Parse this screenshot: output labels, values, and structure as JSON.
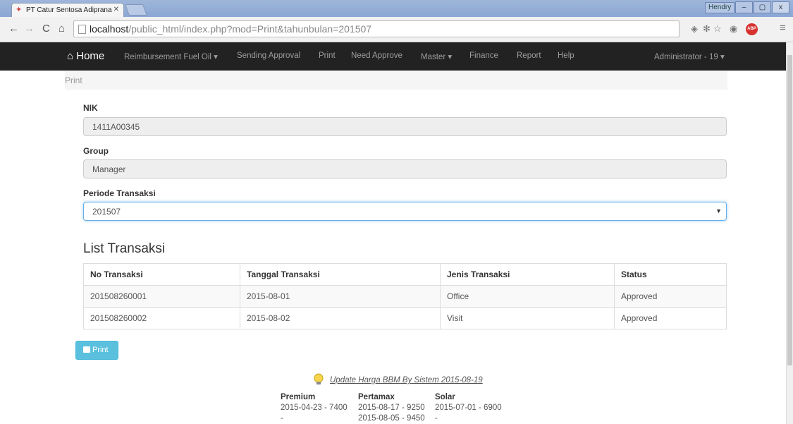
{
  "browser": {
    "tab_title": "PT Catur Sentosa Adiprana",
    "url_host": "localhost",
    "url_path": "/public_html/index.php?mod=Print&tahunbulan=201507",
    "user_badge": "Hendry",
    "minimize": "–",
    "maximize": "▢",
    "close": "x"
  },
  "navbar": {
    "home": "Home",
    "items": [
      "Reimbursement Fuel Oil",
      "Sending Approval",
      "Print",
      "Need Approve",
      "Master",
      "Finance",
      "Report",
      "Help"
    ],
    "user": "Administrator - 19"
  },
  "breadcrumb": "Print",
  "form": {
    "nik_label": "NIK",
    "nik_value": "1411A00345",
    "group_label": "Group",
    "group_value": "Manager",
    "periode_label": "Periode Transaksi",
    "periode_value": "201507"
  },
  "list": {
    "title": "List Transaksi",
    "headers": [
      "No Transaksi",
      "Tanggal Transaksi",
      "Jenis Transaksi",
      "Status"
    ],
    "rows": [
      [
        "201508260001",
        "2015-08-01",
        "Office",
        "Approved"
      ],
      [
        "201508260002",
        "2015-08-02",
        "Visit",
        "Approved"
      ]
    ]
  },
  "print_button": "Print",
  "bbm": {
    "link": "Update Harga BBM By Sistem 2015-08-19",
    "columns": [
      {
        "name": "Premium",
        "lines": [
          "2015-04-23 - 7400",
          "-"
        ]
      },
      {
        "name": "Pertamax",
        "lines": [
          "2015-08-17 - 9250",
          "2015-08-05 - 9450"
        ]
      },
      {
        "name": "Solar",
        "lines": [
          "2015-07-01 - 6900",
          "-"
        ]
      }
    ]
  }
}
